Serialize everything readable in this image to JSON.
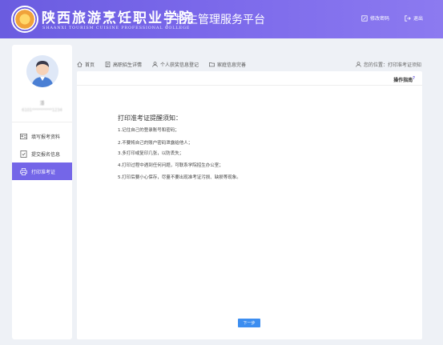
{
  "header": {
    "school_name_cn": "陕西旅游烹饪职业学院",
    "school_name_en": "SHAANXI TOURISM CUISINE PROFESSIONAL COLLEGE",
    "platform_title": "招生管理服务平台",
    "change_password": "修改密码",
    "logout": "退出",
    "accent_color": "#7466e8"
  },
  "sidebar": {
    "user_name": "潘",
    "user_id": "6101**********1234",
    "items": [
      {
        "label": "填写报考资料",
        "icon": "id-card-icon"
      },
      {
        "label": "提交报名信息",
        "icon": "checklist-icon"
      },
      {
        "label": "打印准考证",
        "icon": "printer-icon",
        "active": true
      }
    ]
  },
  "topnav": {
    "items": [
      {
        "label": "首页",
        "icon": "home-icon"
      },
      {
        "label": "高职招生详情",
        "icon": "document-icon"
      },
      {
        "label": "个人获奖信息登记",
        "icon": "user-icon"
      },
      {
        "label": "家庭信息完善",
        "icon": "folder-icon"
      }
    ],
    "current_position": "您的位置：打印准考证须知"
  },
  "content": {
    "guide_label": "操作指南",
    "guide_mark": "?",
    "notice_title": "打印准考证提醒须知：",
    "notice_items": [
      "1.记住自己的登录账号和密码；",
      "2.不要将自己的账户密码泄露给他人；",
      "3.多打印或复印几张，以防丢失；",
      "4.打印过程中遇到任何问题，可联系学院招生办公室；",
      "5.打印后要小心保存，尽量不要出现准考证污损、缺损等现象。"
    ],
    "next_button": "下一步"
  }
}
